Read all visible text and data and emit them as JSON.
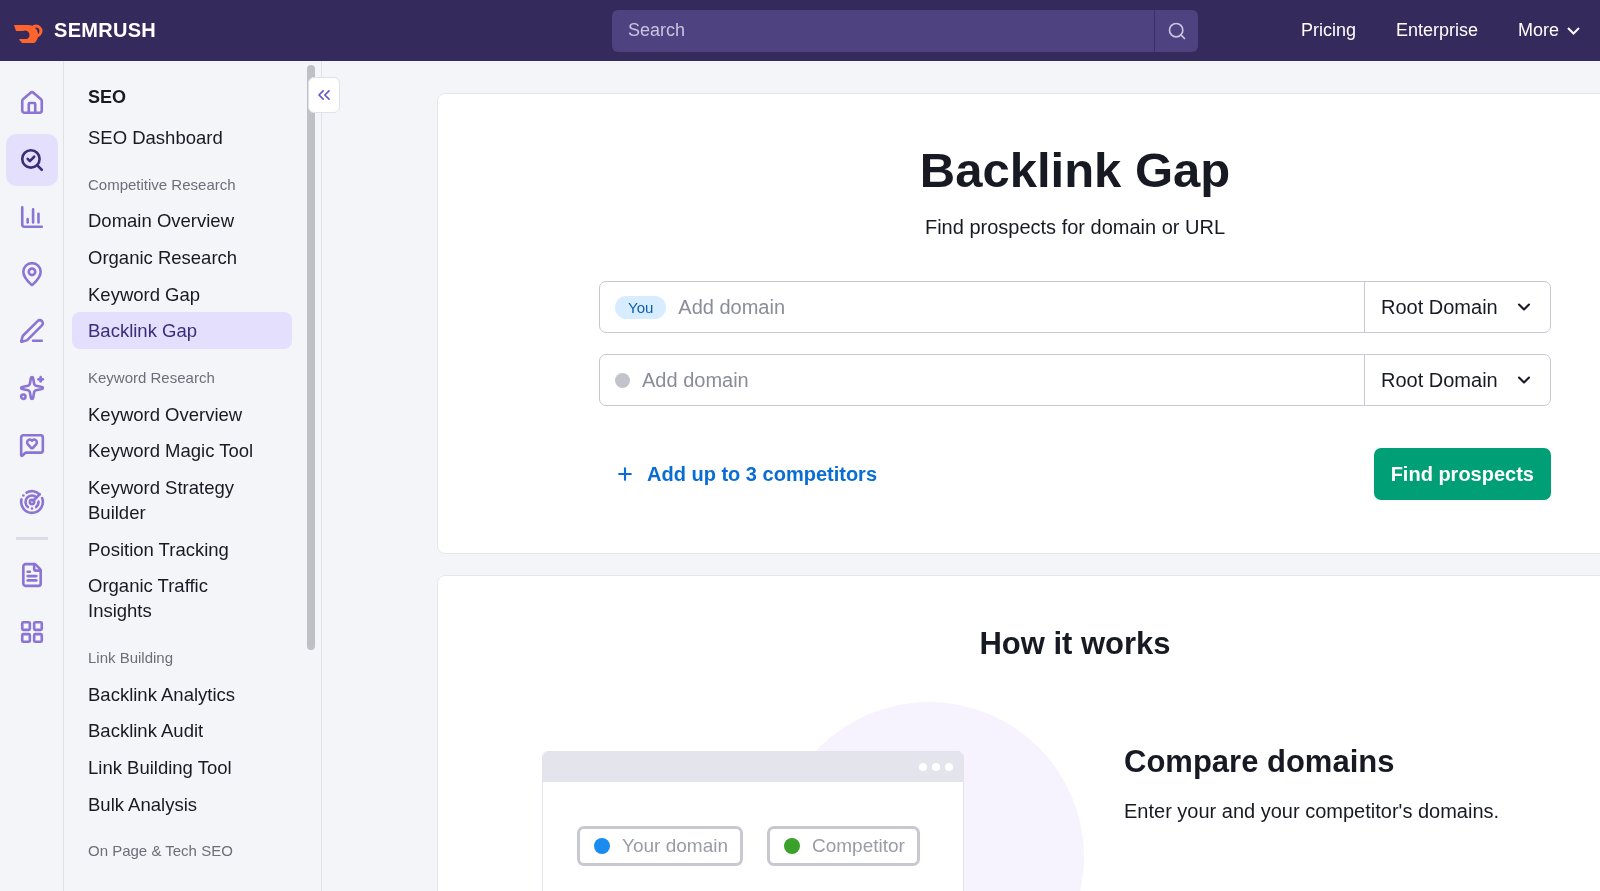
{
  "header": {
    "logo": "SEMRUSH",
    "search": {
      "placeholder": "Search"
    },
    "links": [
      {
        "label": "Pricing",
        "dropdown": false
      },
      {
        "label": "Enterprise",
        "dropdown": false
      },
      {
        "label": "More",
        "dropdown": true
      }
    ]
  },
  "rail": [
    {
      "kind": "home",
      "selected": false
    },
    {
      "kind": "seo",
      "selected": true
    },
    {
      "kind": "chart",
      "selected": false
    },
    {
      "kind": "pin",
      "selected": false
    },
    {
      "kind": "pen",
      "selected": false
    },
    {
      "kind": "sparkle",
      "selected": false
    },
    {
      "kind": "heart",
      "selected": false
    },
    {
      "kind": "cursor",
      "selected": false
    },
    {
      "kind": "divider"
    },
    {
      "kind": "doc",
      "selected": false
    },
    {
      "kind": "apps",
      "selected": false
    }
  ],
  "sidebar": {
    "title": "SEO",
    "sections": [
      {
        "items": [
          {
            "label": "SEO Dashboard",
            "selected": false
          }
        ]
      },
      {
        "title": "Competitive Research",
        "items": [
          {
            "label": "Domain Overview",
            "selected": false
          },
          {
            "label": "Organic Research",
            "selected": false
          },
          {
            "label": "Keyword Gap",
            "selected": false
          },
          {
            "label": "Backlink Gap",
            "selected": true
          }
        ]
      },
      {
        "title": "Keyword Research",
        "items": [
          {
            "label": "Keyword Overview",
            "selected": false
          },
          {
            "label": "Keyword Magic Tool",
            "selected": false
          },
          {
            "label": "Keyword Strategy Builder",
            "selected": false
          },
          {
            "label": "Position Tracking",
            "selected": false
          },
          {
            "label": "Organic Traffic Insights",
            "selected": false
          }
        ]
      },
      {
        "title": "Link Building",
        "items": [
          {
            "label": "Backlink Analytics",
            "selected": false
          },
          {
            "label": "Backlink Audit",
            "selected": false
          },
          {
            "label": "Link Building Tool",
            "selected": false
          },
          {
            "label": "Bulk Analysis",
            "selected": false
          }
        ]
      },
      {
        "title": "On Page & Tech SEO"
      }
    ]
  },
  "tool": {
    "title": "Backlink Gap",
    "subtitle": "Find prospects for domain or URL",
    "domains": [
      {
        "kind": "you",
        "badge": "You",
        "placeholder": "Add domain",
        "scope": "Root Domain"
      },
      {
        "kind": "competitor",
        "placeholder": "Add domain",
        "scope": "Root Domain"
      }
    ],
    "add_link": "Add up to 3 competitors",
    "submit": "Find prospects"
  },
  "how": {
    "title": "How it works",
    "chips": [
      {
        "label": "Your domain",
        "color": "#1a8cf0"
      },
      {
        "label": "Competitor",
        "color": "#3aa12a"
      }
    ],
    "step_title": "Compare domains",
    "step_text": "Enter your and your competitor's domains."
  }
}
